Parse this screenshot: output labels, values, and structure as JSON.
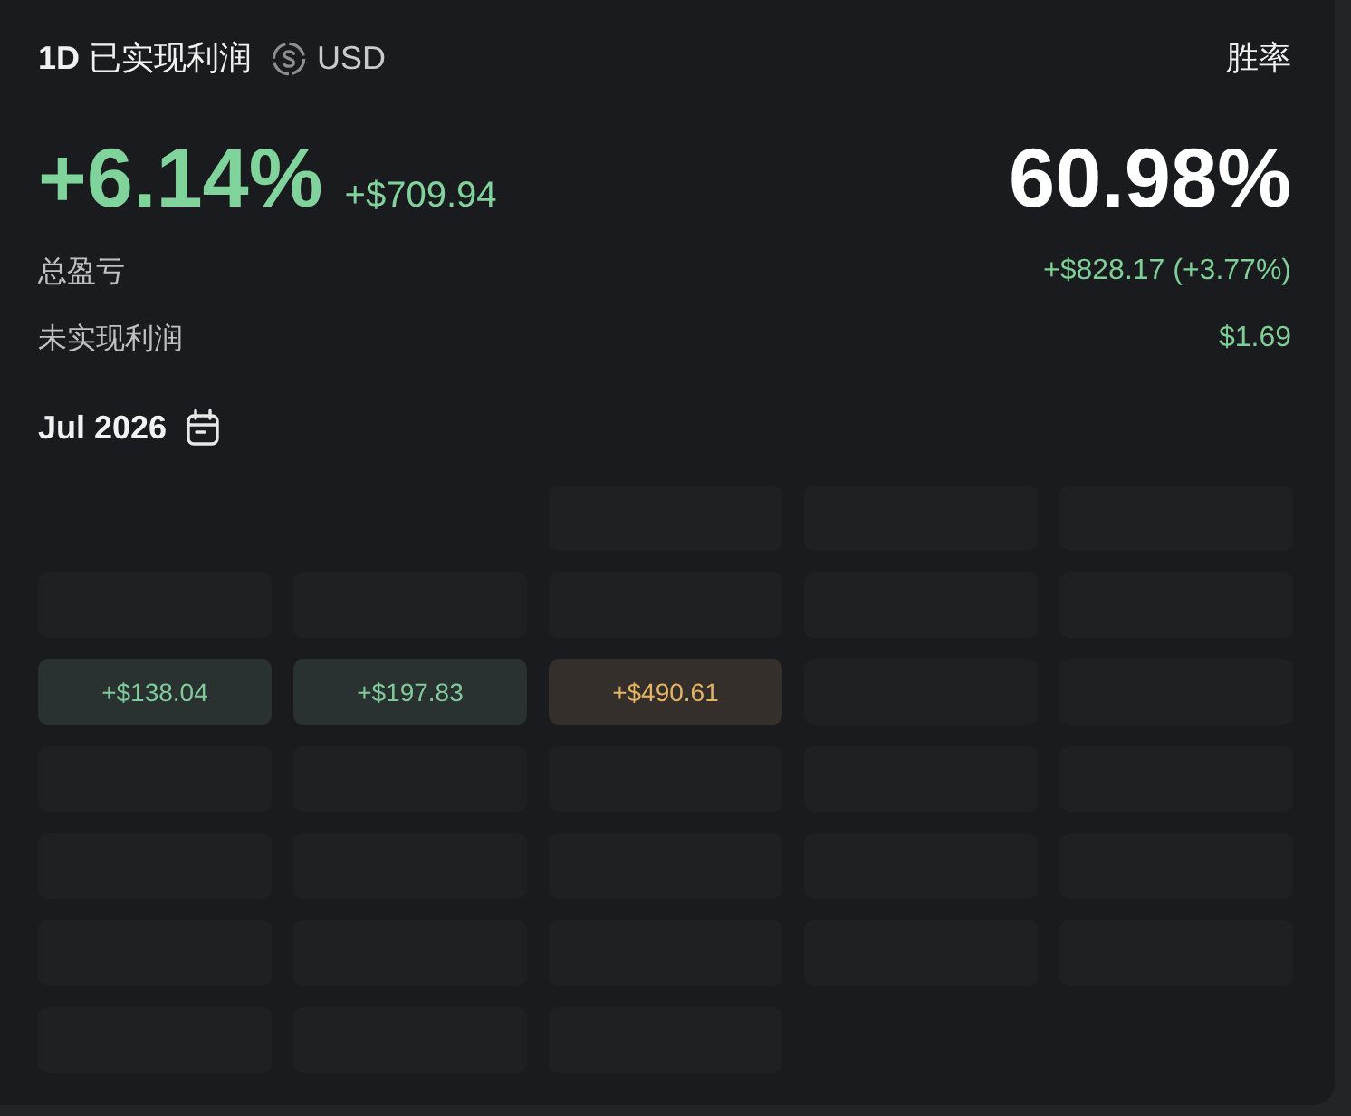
{
  "header": {
    "title": "**1D** 已实现利润",
    "currency": "USD",
    "win_rate_label": "胜率"
  },
  "summary": {
    "pnl_percent": "+6.14%",
    "pnl_amount": "+$709.94",
    "win_rate": "60.98%"
  },
  "metrics": [
    {
      "label": "总盈亏",
      "value": "+$828.17 (+3.77%)"
    },
    {
      "label": "未实现利润",
      "value": "$1.69"
    }
  ],
  "calendar": {
    "month": "Jul 2026",
    "weeks": [
      [
        {
          "kind": "empty"
        },
        {
          "kind": "empty"
        },
        {
          "kind": "empty"
        }
      ],
      [
        {
          "kind": "empty"
        },
        {
          "kind": "empty"
        },
        {
          "kind": "empty"
        },
        {
          "kind": "empty"
        },
        {
          "kind": "empty"
        }
      ],
      [
        {
          "kind": "gain",
          "value": "+$138.04",
          "color": "#80c99a"
        },
        {
          "kind": "gain",
          "value": "+$197.83",
          "color": "#80c99a"
        },
        {
          "kind": "gain",
          "value": "+$490.61",
          "color": "#e4b463"
        },
        {
          "kind": "empty"
        },
        {
          "kind": "empty"
        }
      ],
      [
        {
          "kind": "empty"
        },
        {
          "kind": "empty"
        },
        {
          "kind": "empty"
        },
        {
          "kind": "empty"
        },
        {
          "kind": "empty"
        }
      ],
      [
        {
          "kind": "empty"
        },
        {
          "kind": "empty"
        },
        {
          "kind": "empty"
        },
        {
          "kind": "empty"
        },
        {
          "kind": "empty"
        }
      ],
      [
        {
          "kind": "empty"
        },
        {
          "kind": "empty"
        },
        {
          "kind": "empty"
        },
        {
          "kind": "empty"
        },
        {
          "kind": "empty"
        }
      ],
      [
        {
          "kind": "empty"
        },
        {
          "kind": "empty"
        },
        {
          "kind": "empty"
        }
      ]
    ]
  }
}
